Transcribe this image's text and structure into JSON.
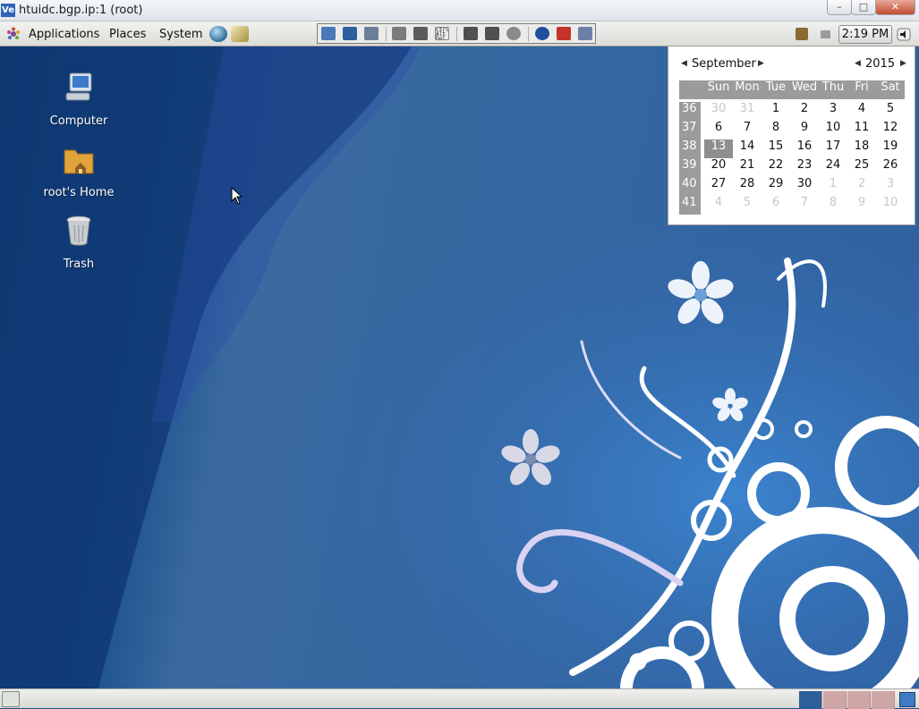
{
  "window": {
    "title": "htuidc.bgp.ip:1 (root)",
    "app_icon": "Ve",
    "minimize_symbol": "–",
    "maximize_symbol": "□",
    "close_symbol": "✕"
  },
  "top_panel": {
    "menus": [
      "Applications",
      "Places",
      "System"
    ],
    "launchers": [
      "web-browser-icon",
      "mail-client-icon"
    ],
    "vnc_toolbar_icons": [
      "options-icon",
      "save-icon",
      "close-conn-icon",
      "settings-icon",
      "fullscreen-icon",
      "ctrl-alt-del-icon",
      "send-file-icon",
      "receive-file-icon",
      "chat-icon",
      "info-icon",
      "disconnect-icon",
      "windows-icon"
    ],
    "ctrl_alt_del_text": "Ctrl\nAlt\nDel",
    "clock": "2:19 PM"
  },
  "desktop": {
    "icons": [
      {
        "label": "Computer",
        "icon": "computer-icon"
      },
      {
        "label": "root's Home",
        "icon": "home-folder-icon"
      },
      {
        "label": "Trash",
        "icon": "trash-icon"
      }
    ]
  },
  "calendar": {
    "month": "September",
    "year": "2015",
    "weekdays": [
      "Sun",
      "Mon",
      "Tue",
      "Wed",
      "Thu",
      "Fri",
      "Sat"
    ],
    "weeks": [
      {
        "week": "36",
        "days": [
          "30",
          "31",
          "1",
          "2",
          "3",
          "4",
          "5"
        ],
        "other": [
          true,
          true,
          false,
          false,
          false,
          false,
          false
        ]
      },
      {
        "week": "37",
        "days": [
          "6",
          "7",
          "8",
          "9",
          "10",
          "11",
          "12"
        ],
        "other": [
          false,
          false,
          false,
          false,
          false,
          false,
          false
        ]
      },
      {
        "week": "38",
        "days": [
          "13",
          "14",
          "15",
          "16",
          "17",
          "18",
          "19"
        ],
        "other": [
          false,
          false,
          false,
          false,
          false,
          false,
          false
        ]
      },
      {
        "week": "39",
        "days": [
          "20",
          "21",
          "22",
          "23",
          "24",
          "25",
          "26"
        ],
        "other": [
          false,
          false,
          false,
          false,
          false,
          false,
          false
        ]
      },
      {
        "week": "40",
        "days": [
          "27",
          "28",
          "29",
          "30",
          "1",
          "2",
          "3"
        ],
        "other": [
          false,
          false,
          false,
          false,
          true,
          true,
          true
        ]
      },
      {
        "week": "41",
        "days": [
          "4",
          "5",
          "6",
          "7",
          "8",
          "9",
          "10"
        ],
        "other": [
          true,
          true,
          true,
          true,
          true,
          true,
          true
        ]
      }
    ],
    "today": "13"
  },
  "bottom_panel": {
    "workspaces": 4,
    "active_workspace": 1,
    "colors": {
      "active": "#2f5f9a",
      "inactive": "#cfa6a6"
    }
  }
}
